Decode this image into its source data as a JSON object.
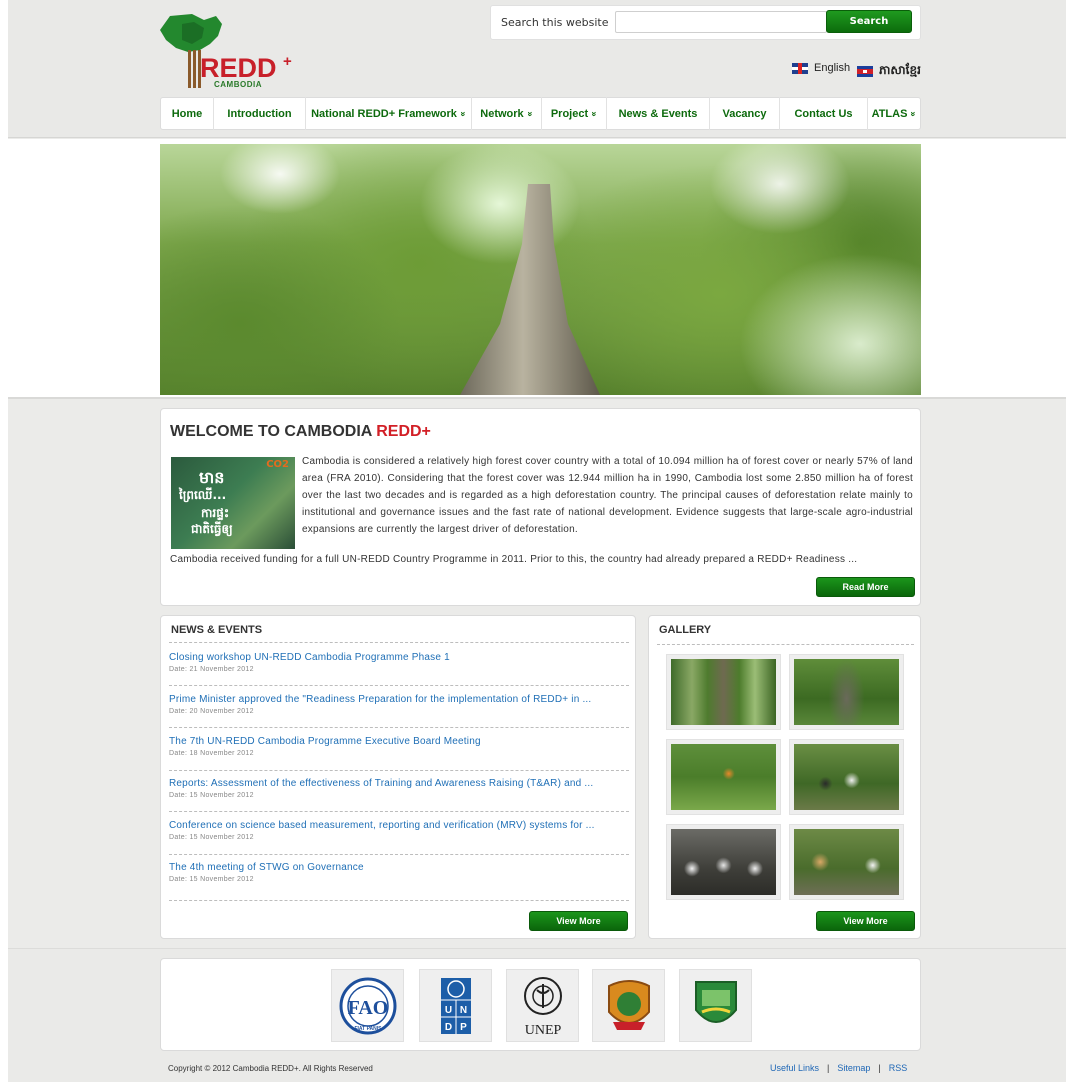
{
  "header": {
    "logo_text": "REDD",
    "logo_plus": "+",
    "logo_sub": "CAMBODIA",
    "search_label": "Search this website",
    "search_value": "",
    "search_button": "Search",
    "lang_en": "English",
    "lang_km": "ភាសាខ្មែរ"
  },
  "nav": {
    "items": [
      {
        "label": "Home"
      },
      {
        "label": "Introduction"
      },
      {
        "label": "National REDD+ Framework",
        "dropdown": true
      },
      {
        "label": "Network",
        "dropdown": true
      },
      {
        "label": "Project",
        "dropdown": true
      },
      {
        "label": "News & Events"
      },
      {
        "label": "Vacancy"
      },
      {
        "label": "Contact Us"
      },
      {
        "label": "ATLAS",
        "dropdown": true
      }
    ],
    "chevron": "»"
  },
  "welcome": {
    "title_a": "WELCOME TO CAMBODIA ",
    "title_b": "REDD+",
    "image_texts": [
      "មាន",
      "ព្រៃឈើ...",
      "ការផ្ទះ",
      "ជាតិធ្វើឲ្យ"
    ],
    "image_co2": "CO2",
    "paragraph1": "Cambodia is considered a relatively high forest cover country with a total of 10.094 million ha of forest cover or nearly 57% of land area (FRA 2010). Considering that the forest cover was 12.944 million ha in 1990, Cambodia lost some 2.850 million ha of forest over the last two decades and is regarded as a high deforestation country. The principal causes of deforestation relate mainly to institutional and governance issues and the fast rate of national development. Evidence suggests that large-scale agro-industrial expansions are currently the largest driver of deforestation.",
    "paragraph2": "Cambodia received funding for a full UN-REDD Country Programme in 2011. Prior to this, the country had already prepared a REDD+ Readiness ...",
    "read_more": "Read More"
  },
  "news": {
    "title": "NEWS & EVENTS",
    "items": [
      {
        "title": "Closing workshop UN-REDD Cambodia Programme Phase 1",
        "date": "Date: 21 November 2012"
      },
      {
        "title": "Prime Minister approved the \"Readiness Preparation for the implementation of REDD+ in ...",
        "date": "Date: 20 November 2012"
      },
      {
        "title": "The 7th UN-REDD Cambodia Programme Executive Board Meeting",
        "date": "Date: 18 November 2012"
      },
      {
        "title": "Reports: Assessment of the effectiveness of Training and Awareness Raising (T&AR) and ...",
        "date": "Date: 15 November 2012"
      },
      {
        "title": "Conference on science based measurement, reporting and verification (MRV) systems for ...",
        "date": "Date: 15 November 2012"
      },
      {
        "title": "The 4th meeting of STWG on Governance",
        "date": "Date: 15 November 2012"
      }
    ],
    "view_more": "View More"
  },
  "gallery": {
    "title": "GALLERY",
    "view_more": "View More"
  },
  "partners": {
    "fao_text": "FAO",
    "fao_motto": "FIAT PANIS",
    "undp_text": [
      "U",
      "N",
      "D",
      "P"
    ],
    "unep_text": "UNEP"
  },
  "footer": {
    "copyright": "Copyright © 2012 Cambodia REDD+. All Rights Reserved",
    "links": [
      "Useful Links",
      "Sitemap",
      "RSS"
    ],
    "separator": "|"
  },
  "colors": {
    "brand_green": "#0d6a0d",
    "brand_red": "#d21f26",
    "link_blue": "#1f6fb6"
  }
}
